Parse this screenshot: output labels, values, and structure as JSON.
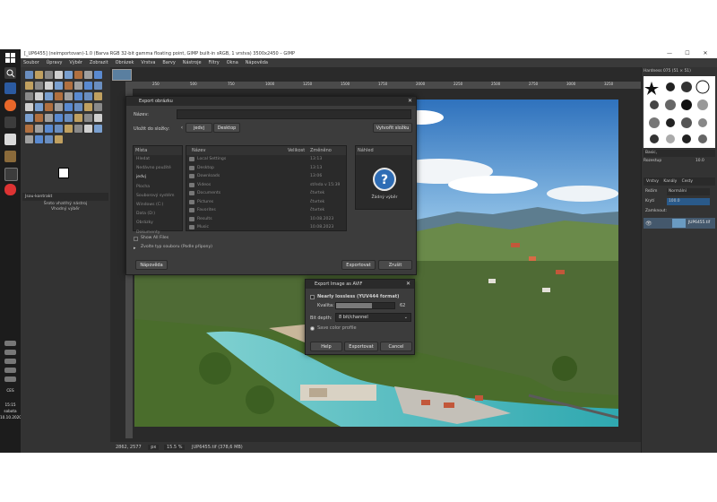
{
  "window": {
    "title": "[_UP6455] (neimportovan)-1.0 (Barva RGB 32-bit gamma floating point, GIMP built-in sRGB, 1 vrstva) 3500x2450 – GIMP",
    "min": "—",
    "max": "☐",
    "close": "✕"
  },
  "menu": [
    "Soubor",
    "Úpravy",
    "Výběr",
    "Zobrazit",
    "Obrázek",
    "Vrstva",
    "Barvy",
    "Nástroje",
    "Filtry",
    "Okna",
    "Nápověda"
  ],
  "toolbox": {
    "label_line1": "Šroto vhatřný nástroj",
    "label_line2": "Vhodný výběr",
    "tab_label": "Jsou-kontrakt"
  },
  "taskbar": {
    "lang": "CES",
    "time": "15:15",
    "day": "sobota",
    "date": "10.10.2020"
  },
  "ruler_ticks": [
    "250",
    "500",
    "750",
    "1000",
    "1250",
    "1500",
    "1750",
    "2000",
    "2250",
    "2500",
    "2750",
    "3000",
    "3250"
  ],
  "statusbar": {
    "coords": "2862, 2577",
    "unit": "px",
    "zoom": "15.5 %",
    "file": "JUP6455.tif (378,6 MB)"
  },
  "dock": {
    "brushes_title": "Hardness 075 (51 × 51)",
    "brush_name": "Basic,",
    "spacing_label": "Rozestup",
    "spacing_value": "10.0",
    "tabs": [
      "Vrstvy",
      "Kanály",
      "Cesty"
    ],
    "mode_label": "Režim",
    "mode_value": "Normální",
    "opacity_label": "Krytí",
    "opacity_value": "100.0",
    "lock_label": "Zamknout:",
    "layer_name": "JUP6455.tif"
  },
  "export_dialog": {
    "title": "Export obrázku",
    "name_label": "Název:",
    "name_value": "",
    "save_in_label": "Uložit do složky:",
    "path": [
      "jedvj",
      "Desktop"
    ],
    "create_folder": "Vytvořit složku",
    "places_header": "Místa",
    "places": [
      "Hledat",
      "Nedávno použité",
      "jedvj",
      "Plocha",
      "Souborový systém",
      "Windows (C:)",
      "Data (D:)",
      "Obrázky",
      "Dokumenty"
    ],
    "columns": [
      "Název",
      "Velikost",
      "Změněno"
    ],
    "files": [
      {
        "name": "Local Settings",
        "size": "",
        "date": "13:13"
      },
      {
        "name": "Desktop",
        "size": "",
        "date": "13:13"
      },
      {
        "name": "Downloads",
        "size": "",
        "date": "13:06"
      },
      {
        "name": "Videos",
        "size": "",
        "date": "středa v 15:39"
      },
      {
        "name": "Documents",
        "size": "",
        "date": "čtvrtek"
      },
      {
        "name": "Pictures",
        "size": "",
        "date": "čtvrtek"
      },
      {
        "name": "Favorites",
        "size": "",
        "date": "čtvrtek"
      },
      {
        "name": "Results",
        "size": "",
        "date": "10.08.2023"
      },
      {
        "name": "Music",
        "size": "",
        "date": "10.08.2023"
      }
    ],
    "preview_header": "Náhled",
    "preview_text": "Žádný výběr",
    "show_all": "Show All Files",
    "file_type": "Zvolte typ souboru (Podle přípony)",
    "help": "Nápověda",
    "export": "Exportovat",
    "cancel": "Zrušit"
  },
  "avif_dialog": {
    "title": "Export Image as AVIF",
    "lossless": "Nearly lossless (YUV444 format)",
    "quality_label": "Kvalita:",
    "quality_value": "62",
    "quality_fraction": 0.62,
    "bit_depth_label": "Bit depth:",
    "bit_depth_value": "8 bit/channel",
    "save_profile": "Save color profile",
    "help": "Help",
    "export": "Exportovat",
    "cancel": "Cancel"
  },
  "colors": {
    "sky": "#3f86c9",
    "water": "#3fb6b8",
    "vegetation": "#4f7a2e",
    "panel": "#3c3c3c",
    "accent": "#2f6db5"
  }
}
